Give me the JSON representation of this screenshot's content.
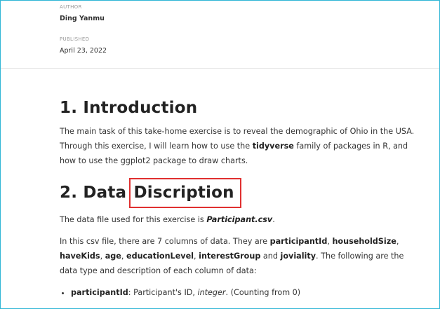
{
  "meta": {
    "author_label": "AUTHOR",
    "author_name": "Ding Yanmu",
    "published_label": "PUBLISHED",
    "published_date": "April 23, 2022"
  },
  "section1": {
    "heading": "1. Introduction",
    "p1_a": "The main task of this take-home exercise is to reveal the demographic of Ohio in the USA. Through this exercise, I will learn how to use the ",
    "p1_b": "tidyverse",
    "p1_c": " family of packages in R, and how to use the ggplot2 package to draw charts."
  },
  "section2": {
    "heading_prefix": "2. Data ",
    "heading_boxed": "Discription",
    "p1_a": "The data file used for this exercise is ",
    "p1_file": "Participant.csv",
    "p1_c": ".",
    "p2_a": "In this csv file, there are 7 columns of data. They are ",
    "col1": "participantId",
    "sep": ", ",
    "col2": "householdSize",
    "col3": "haveKids",
    "col4": "age",
    "col5": "educationLevel",
    "col6": "interestGroup",
    "and": " and ",
    "col7": "joviality",
    "p2_tail": ". The following are the data type and description of each column of data:",
    "bullet1_name": "participantId",
    "bullet1_a": ": Participant's ID, ",
    "bullet1_type": "integer",
    "bullet1_c": ". (Counting from 0)"
  },
  "colors": {
    "frame_border": "#2fb6d6",
    "highlight_box": "#e03030"
  }
}
